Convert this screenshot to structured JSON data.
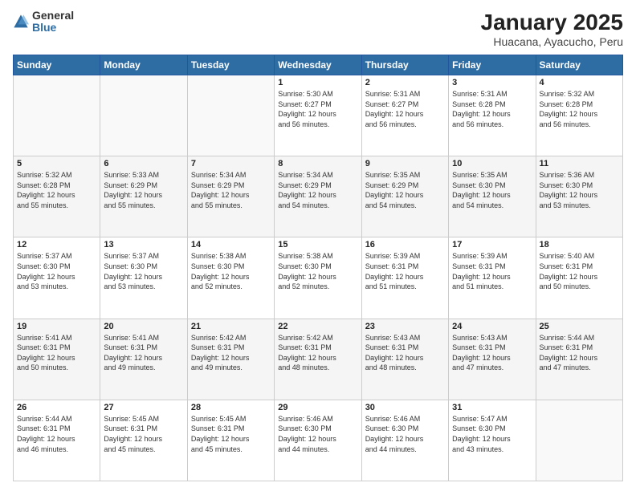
{
  "logo": {
    "general": "General",
    "blue": "Blue"
  },
  "header": {
    "title": "January 2025",
    "subtitle": "Huacana, Ayacucho, Peru"
  },
  "weekdays": [
    "Sunday",
    "Monday",
    "Tuesday",
    "Wednesday",
    "Thursday",
    "Friday",
    "Saturday"
  ],
  "weeks": [
    [
      {
        "day": "",
        "info": ""
      },
      {
        "day": "",
        "info": ""
      },
      {
        "day": "",
        "info": ""
      },
      {
        "day": "1",
        "info": "Sunrise: 5:30 AM\nSunset: 6:27 PM\nDaylight: 12 hours\nand 56 minutes."
      },
      {
        "day": "2",
        "info": "Sunrise: 5:31 AM\nSunset: 6:27 PM\nDaylight: 12 hours\nand 56 minutes."
      },
      {
        "day": "3",
        "info": "Sunrise: 5:31 AM\nSunset: 6:28 PM\nDaylight: 12 hours\nand 56 minutes."
      },
      {
        "day": "4",
        "info": "Sunrise: 5:32 AM\nSunset: 6:28 PM\nDaylight: 12 hours\nand 56 minutes."
      }
    ],
    [
      {
        "day": "5",
        "info": "Sunrise: 5:32 AM\nSunset: 6:28 PM\nDaylight: 12 hours\nand 55 minutes."
      },
      {
        "day": "6",
        "info": "Sunrise: 5:33 AM\nSunset: 6:29 PM\nDaylight: 12 hours\nand 55 minutes."
      },
      {
        "day": "7",
        "info": "Sunrise: 5:34 AM\nSunset: 6:29 PM\nDaylight: 12 hours\nand 55 minutes."
      },
      {
        "day": "8",
        "info": "Sunrise: 5:34 AM\nSunset: 6:29 PM\nDaylight: 12 hours\nand 54 minutes."
      },
      {
        "day": "9",
        "info": "Sunrise: 5:35 AM\nSunset: 6:29 PM\nDaylight: 12 hours\nand 54 minutes."
      },
      {
        "day": "10",
        "info": "Sunrise: 5:35 AM\nSunset: 6:30 PM\nDaylight: 12 hours\nand 54 minutes."
      },
      {
        "day": "11",
        "info": "Sunrise: 5:36 AM\nSunset: 6:30 PM\nDaylight: 12 hours\nand 53 minutes."
      }
    ],
    [
      {
        "day": "12",
        "info": "Sunrise: 5:37 AM\nSunset: 6:30 PM\nDaylight: 12 hours\nand 53 minutes."
      },
      {
        "day": "13",
        "info": "Sunrise: 5:37 AM\nSunset: 6:30 PM\nDaylight: 12 hours\nand 53 minutes."
      },
      {
        "day": "14",
        "info": "Sunrise: 5:38 AM\nSunset: 6:30 PM\nDaylight: 12 hours\nand 52 minutes."
      },
      {
        "day": "15",
        "info": "Sunrise: 5:38 AM\nSunset: 6:30 PM\nDaylight: 12 hours\nand 52 minutes."
      },
      {
        "day": "16",
        "info": "Sunrise: 5:39 AM\nSunset: 6:31 PM\nDaylight: 12 hours\nand 51 minutes."
      },
      {
        "day": "17",
        "info": "Sunrise: 5:39 AM\nSunset: 6:31 PM\nDaylight: 12 hours\nand 51 minutes."
      },
      {
        "day": "18",
        "info": "Sunrise: 5:40 AM\nSunset: 6:31 PM\nDaylight: 12 hours\nand 50 minutes."
      }
    ],
    [
      {
        "day": "19",
        "info": "Sunrise: 5:41 AM\nSunset: 6:31 PM\nDaylight: 12 hours\nand 50 minutes."
      },
      {
        "day": "20",
        "info": "Sunrise: 5:41 AM\nSunset: 6:31 PM\nDaylight: 12 hours\nand 49 minutes."
      },
      {
        "day": "21",
        "info": "Sunrise: 5:42 AM\nSunset: 6:31 PM\nDaylight: 12 hours\nand 49 minutes."
      },
      {
        "day": "22",
        "info": "Sunrise: 5:42 AM\nSunset: 6:31 PM\nDaylight: 12 hours\nand 48 minutes."
      },
      {
        "day": "23",
        "info": "Sunrise: 5:43 AM\nSunset: 6:31 PM\nDaylight: 12 hours\nand 48 minutes."
      },
      {
        "day": "24",
        "info": "Sunrise: 5:43 AM\nSunset: 6:31 PM\nDaylight: 12 hours\nand 47 minutes."
      },
      {
        "day": "25",
        "info": "Sunrise: 5:44 AM\nSunset: 6:31 PM\nDaylight: 12 hours\nand 47 minutes."
      }
    ],
    [
      {
        "day": "26",
        "info": "Sunrise: 5:44 AM\nSunset: 6:31 PM\nDaylight: 12 hours\nand 46 minutes."
      },
      {
        "day": "27",
        "info": "Sunrise: 5:45 AM\nSunset: 6:31 PM\nDaylight: 12 hours\nand 45 minutes."
      },
      {
        "day": "28",
        "info": "Sunrise: 5:45 AM\nSunset: 6:31 PM\nDaylight: 12 hours\nand 45 minutes."
      },
      {
        "day": "29",
        "info": "Sunrise: 5:46 AM\nSunset: 6:30 PM\nDaylight: 12 hours\nand 44 minutes."
      },
      {
        "day": "30",
        "info": "Sunrise: 5:46 AM\nSunset: 6:30 PM\nDaylight: 12 hours\nand 44 minutes."
      },
      {
        "day": "31",
        "info": "Sunrise: 5:47 AM\nSunset: 6:30 PM\nDaylight: 12 hours\nand 43 minutes."
      },
      {
        "day": "",
        "info": ""
      }
    ]
  ]
}
